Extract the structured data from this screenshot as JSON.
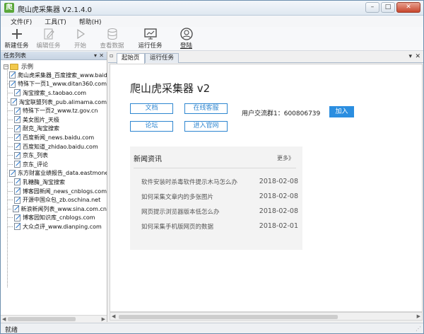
{
  "window": {
    "title": "爬山虎采集器 V2.1.4.0",
    "icon": "app-logo-icon",
    "controls": [
      "minimize-icon",
      "maximize-icon",
      "close-icon"
    ]
  },
  "menu": [
    "文件(F)",
    "工具(T)",
    "帮助(H)"
  ],
  "toolbar": [
    {
      "label": "新建任务",
      "icon": "plus-icon",
      "enabled": true
    },
    {
      "label": "编辑任务",
      "icon": "edit-icon",
      "enabled": false
    },
    {
      "label": "开始",
      "icon": "play-icon",
      "enabled": false
    },
    {
      "label": "查看数据",
      "icon": "database-icon",
      "enabled": false
    },
    {
      "label": "运行任务",
      "icon": "monitor-icon",
      "enabled": true
    },
    {
      "label": "登陆",
      "icon": "user-icon",
      "enabled": true
    }
  ],
  "task_panel": {
    "title": "任务列表",
    "root": "示例",
    "items": [
      "爬山虎采集器_百度搜索_www.baidu.com",
      "特殊下一页1_www.ditan360.com",
      "淘宝搜索_s.taobao.com",
      "淘宝联盟列表_pub.alimama.com",
      "特殊下一页2_www.tz.gov.cn",
      "美女图片_天极",
      "耐克_淘宝搜索",
      "百度新闻_news.baidu.com",
      "百度知道_zhidao.baidu.com",
      "京东_列表",
      "京东_评论",
      "东方财富业绩报告_data.eastmoney.com",
      "乳糖酶_淘宝搜索",
      "博客园新闻_news_cnblogs.com",
      "开源中国众包_zb.oschina.net",
      "新浪新闻列表_www.sina.com.cn",
      "博客园知识库_cnblogs.com",
      "大众点评_www.dianping.com"
    ]
  },
  "tabs": [
    "起始页",
    "运行任务"
  ],
  "start_page": {
    "title": "爬山虎采集器 v2",
    "buttons": {
      "docs": "文档",
      "online_service": "在线客服",
      "forum": "论坛",
      "website": "进入官网"
    },
    "group_text": "用户交流群1：600806739",
    "join": "加入",
    "news": {
      "title": "新闻资讯",
      "more": "更多》",
      "items": [
        {
          "title": "软件安装时杀毒软件提示木马怎么办",
          "date": "2018-02-08"
        },
        {
          "title": "如何采集文章内的多张图片",
          "date": "2018-02-08"
        },
        {
          "title": "网页提示浏览器版本低怎么办",
          "date": "2018-02-08"
        },
        {
          "title": "如何采集手机版网页的数据",
          "date": "2018-02-01"
        }
      ]
    }
  },
  "status": "就绪",
  "colors": {
    "accent": "#2b8ee0",
    "title_gradient": "#dfe8f1",
    "folder": "#f2c94c"
  }
}
